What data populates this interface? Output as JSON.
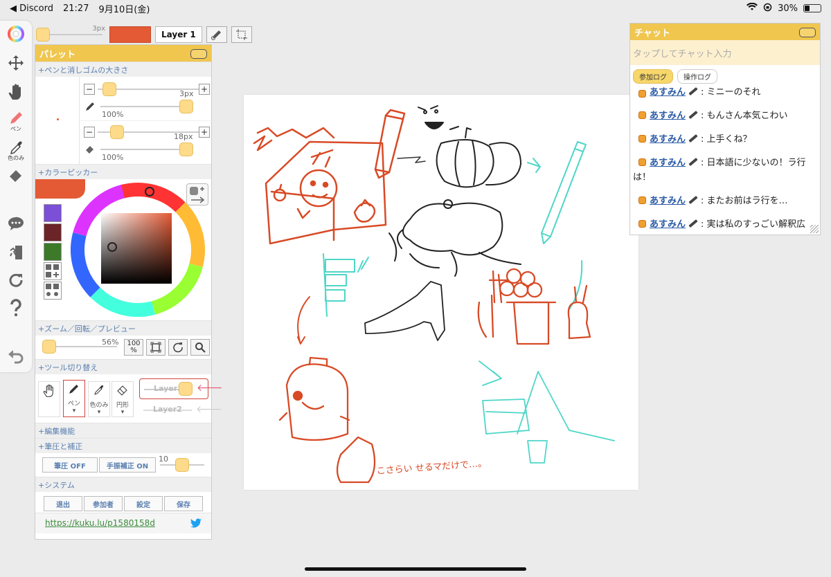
{
  "status_bar": {
    "back_app": "◀ Discord",
    "time": "21:27",
    "date": "9月10日(金)",
    "battery": "30%"
  },
  "left_toolbar": {
    "pen_label": "ペン",
    "eyedropper_label": "色のみ"
  },
  "top_bar": {
    "pen_size": "3px",
    "layer_label": "Layer 1",
    "color": "#e35a35"
  },
  "palette": {
    "title": "パレット",
    "sections": {
      "size": "+ペンと消しゴムの大きさ",
      "color_picker": "+カラーピッカー",
      "zoom": "+ズーム／回転／プレビュー",
      "tools": "+ツール切り替え",
      "edit": "+編集機能",
      "pressure": "+筆圧と補正",
      "system": "+システム"
    },
    "pen_size": "3px",
    "pen_opacity": "100%",
    "eraser_size": "18px",
    "eraser_opacity": "100%",
    "zoom_value": "56%",
    "zoom_100": "100",
    "zoom_100_unit": "%",
    "tools": [
      {
        "label": ""
      },
      {
        "label": "ペン"
      },
      {
        "label": "色のみ"
      },
      {
        "label": "円形"
      }
    ],
    "layers": [
      "Layer1",
      "Layer2"
    ],
    "pressure_off": "筆圧 OFF",
    "stabilizer_on": "手振補正 ON",
    "stabilizer_value": "10",
    "system_buttons": [
      "退出",
      "参加者",
      "設定",
      "保存"
    ],
    "link": "https://kuku.lu/p1580158d",
    "swatches": [
      "#7b4fd6",
      "#6b2428",
      "#3c7a2a"
    ],
    "current_color": "#e35a35"
  },
  "chat": {
    "title": "チャット",
    "input_placeholder": "タップしてチャット入力",
    "tabs": [
      "参加ログ",
      "操作ログ"
    ],
    "messages": [
      {
        "user": "あすみん",
        "text": ": ミニーのそれ"
      },
      {
        "user": "あすみん",
        "text": ": もんさん本気こわい"
      },
      {
        "user": "あすみん",
        "text": ": 上手くね？"
      },
      {
        "user": "あすみん",
        "text": ": 日本語に少ないの！ラ行は！"
      },
      {
        "user": "あすみん",
        "text": ": またお前はラ行を…"
      },
      {
        "user": "あすみん",
        "text": ": 実は私のすっごい解釈広"
      }
    ]
  },
  "canvas": {
    "caption": "こさらい せるマだけで…。"
  }
}
